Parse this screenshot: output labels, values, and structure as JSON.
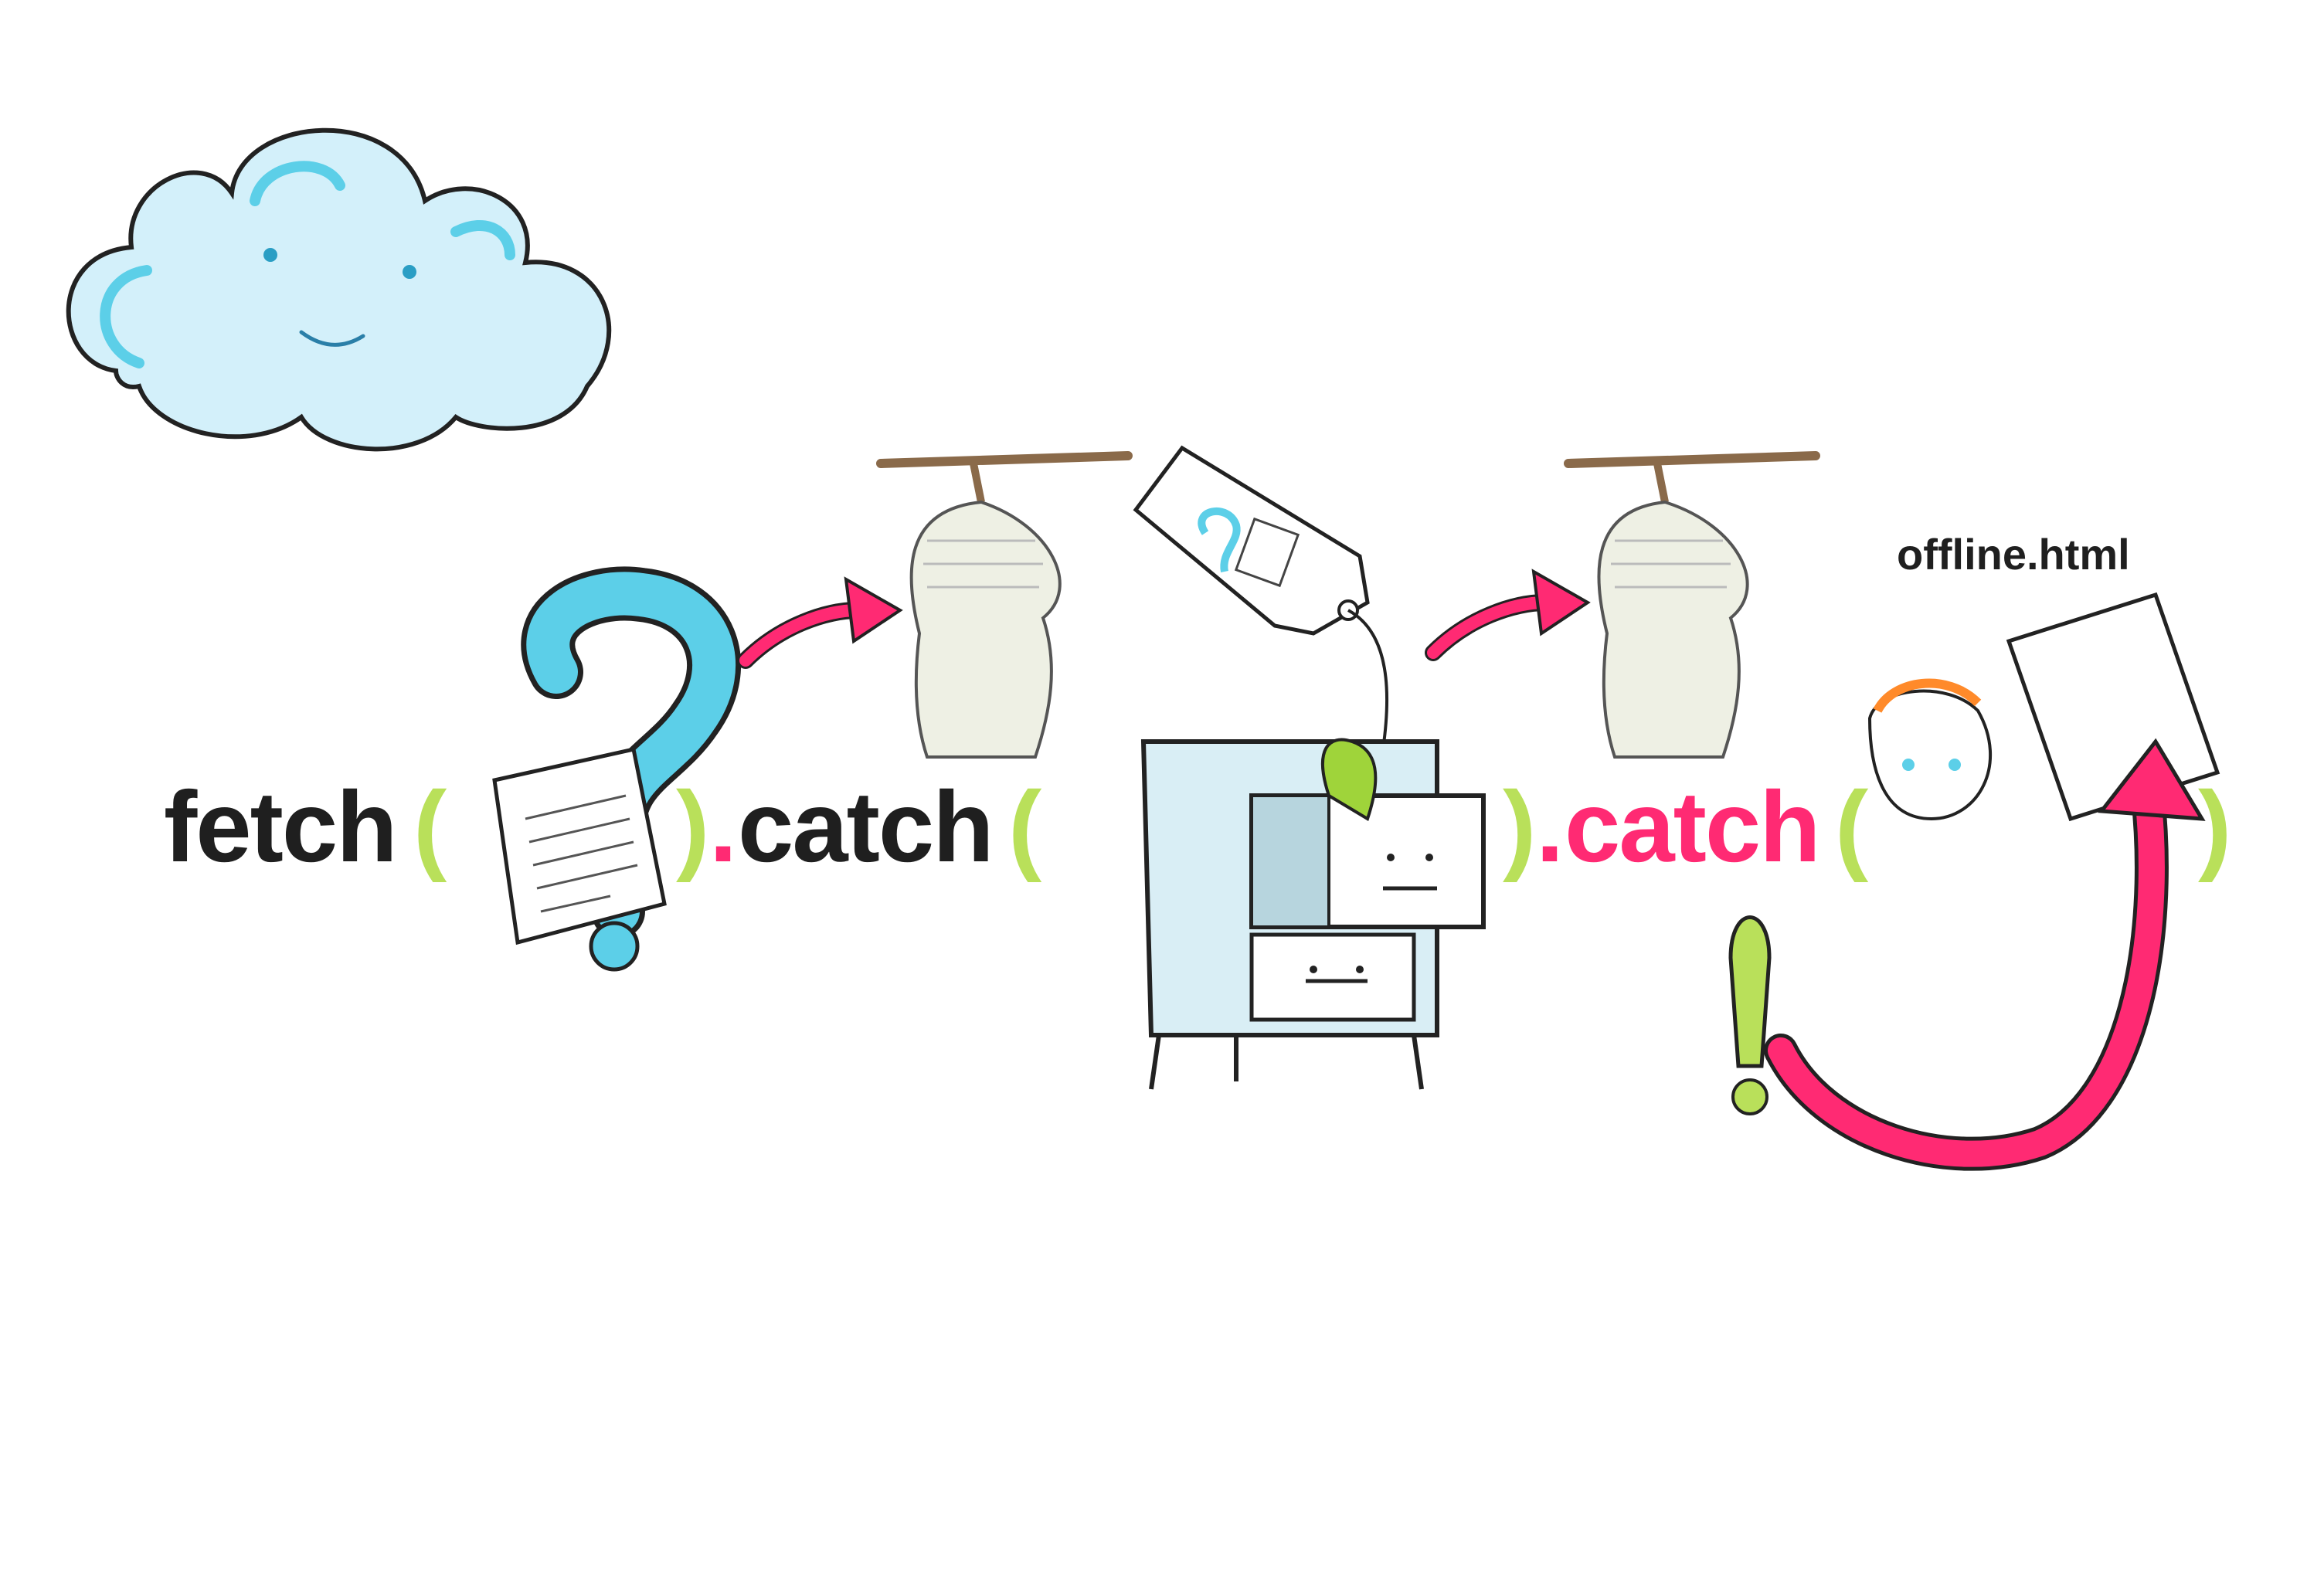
{
  "code": {
    "fetch": "fetch",
    "open1": "(",
    "close1": ")",
    "dot1": ".",
    "catch1": "catch",
    "open2": "(",
    "close2": ")",
    "dot2": ".",
    "catch2": "catch",
    "open3": "(",
    "close3": ")"
  },
  "offline_label": "offline.html",
  "colors": {
    "dark": "#1f1f1f",
    "pink": "#ff2a73",
    "green": "#b9e05a",
    "blue": "#5ccfe8",
    "cloud": "#cfeef8"
  },
  "icons": [
    "cloud-icon",
    "question-mark-icon",
    "document-icon",
    "chrysalis-icon",
    "tag-icon",
    "filing-cabinet-icon",
    "exclamation-icon",
    "offline-page-icon",
    "arrow-icon"
  ]
}
